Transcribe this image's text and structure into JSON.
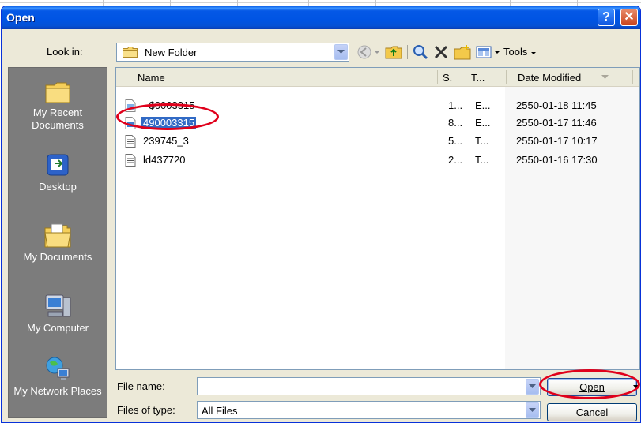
{
  "dialog": {
    "title": "Open",
    "help_glyph": "?",
    "close_glyph": "✕"
  },
  "look_in": {
    "label": "Look in:",
    "value": "New Folder"
  },
  "toolbar": {
    "tools_label": "Tools",
    "icons": [
      "back-icon",
      "up-folder-icon",
      "search-web-icon",
      "delete-icon",
      "new-folder-icon",
      "views-icon"
    ]
  },
  "places": [
    {
      "label": "My Recent Documents",
      "icon": "recent-documents-icon"
    },
    {
      "label": "Desktop",
      "icon": "desktop-icon"
    },
    {
      "label": "My Documents",
      "icon": "my-documents-icon"
    },
    {
      "label": "My Computer",
      "icon": "my-computer-icon"
    },
    {
      "label": "My Network Places",
      "icon": "network-places-icon"
    }
  ],
  "file_list": {
    "columns": [
      "Name",
      "S.",
      "T...",
      "Date Modified"
    ],
    "sorted_by": "Date Modified",
    "rows": [
      {
        "name": "~$0003315",
        "size": "1...",
        "type": "E...",
        "date": "2550-01-18 11:45",
        "icon": "excel-file-icon",
        "selected": false
      },
      {
        "name": "490003315",
        "size": "8...",
        "type": "E...",
        "date": "2550-01-17 11:46",
        "icon": "excel-file-icon",
        "selected": true
      },
      {
        "name": "239745_3",
        "size": "5...",
        "type": "T...",
        "date": "2550-01-17 10:17",
        "icon": "text-file-icon",
        "selected": false
      },
      {
        "name": "ld437720",
        "size": "2...",
        "type": "T...",
        "date": "2550-01-16 17:30",
        "icon": "text-file-icon",
        "selected": false
      }
    ]
  },
  "file_name": {
    "label": "File name:",
    "value": ""
  },
  "file_type": {
    "label": "Files of type:",
    "value": "All Files"
  },
  "buttons": {
    "open": "Open",
    "cancel": "Cancel"
  },
  "colors": {
    "title_bar": "#0054e3",
    "dialog_bg": "#ece9d8",
    "selection": "#316ac5",
    "highlight_oval": "#e0001b"
  }
}
